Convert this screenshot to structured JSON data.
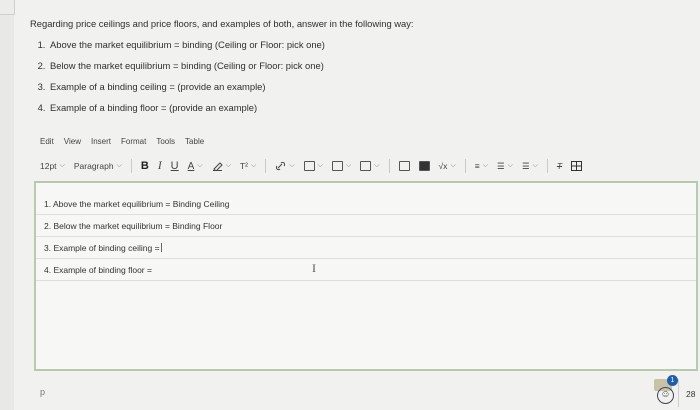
{
  "question": {
    "intro": "Regarding price ceilings and price floors, and examples of both, answer in the following way:",
    "items": [
      "Above the market equilibrium = binding (Ceiling or Floor: pick one)",
      "Below the market equilibrium = binding (Ceiling or Floor: pick one)",
      "Example of a binding ceiling = (provide an example)",
      "Example of a binding floor = (provide an example)"
    ]
  },
  "menubar": {
    "edit": "Edit",
    "view": "View",
    "insert": "Insert",
    "format": "Format",
    "tools": "Tools",
    "table": "Table"
  },
  "toolbar": {
    "font_size": "12pt",
    "paragraph": "Paragraph",
    "bold": "B",
    "italic": "I",
    "underline": "U",
    "text_color": "A",
    "superscript": "T²",
    "ltr": "I ⁋",
    "chevron": "⌵"
  },
  "editor": {
    "lines": [
      "1. Above the market equilibrium = Binding Ceiling",
      "2. Below the market equilibrium = Binding Floor",
      "3. Example of binding ceiling =",
      "4. Example of binding floor ="
    ]
  },
  "statusbar": {
    "path": "p",
    "notification_count": "1",
    "word_count": "28"
  },
  "colors": {
    "editor_border": "#b9c9b0",
    "badge": "#1e5fa8"
  }
}
